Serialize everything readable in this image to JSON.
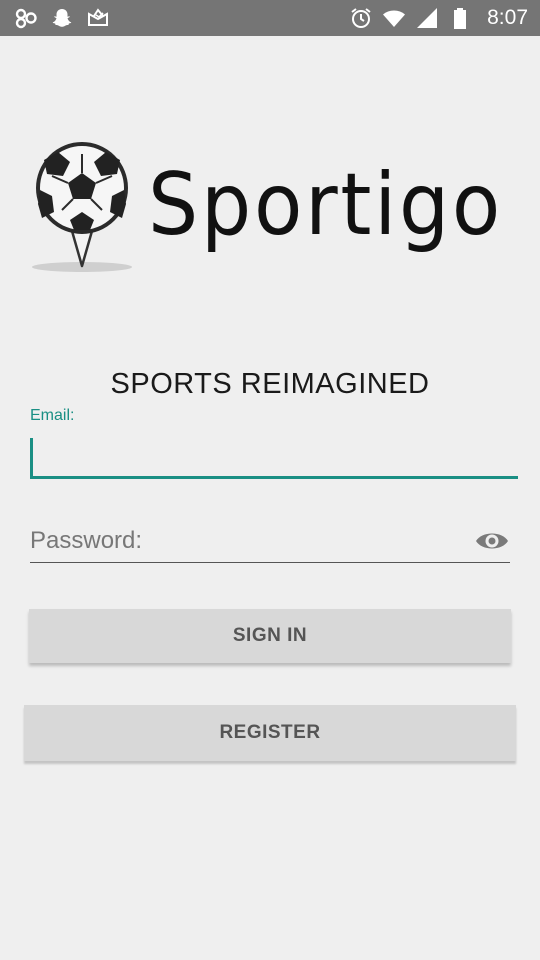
{
  "status_bar": {
    "time": "8:07",
    "left_icons": [
      "infinity-app-icon",
      "snapchat-ghost-icon",
      "inbox-envelope-icon"
    ],
    "right_icons": [
      "alarm-clock-icon",
      "wifi-icon",
      "cell-signal-icon",
      "battery-icon"
    ]
  },
  "logo": {
    "text": "Sportigo",
    "icon": "soccer-ball-pin-icon"
  },
  "tagline": "SPORTS REIMAGINED",
  "form": {
    "email_label": "Email:",
    "email_value": "",
    "password_placeholder": "Password:",
    "password_value": "",
    "show_password_icon": "eye-icon"
  },
  "buttons": {
    "sign_in": "SIGN IN",
    "register": "REGISTER"
  },
  "colors": {
    "accent": "#1a8f84",
    "status_bar": "#757575",
    "background": "#efefef",
    "button_bg": "#d8d8d8",
    "button_text": "#555555"
  }
}
